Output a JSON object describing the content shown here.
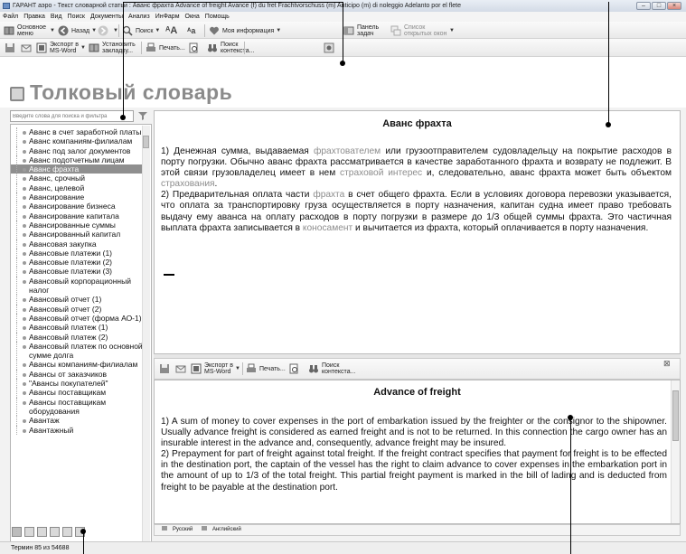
{
  "window": {
    "title": "ГАРАНТ аэро - Текст словарной статьи : Аванс фрахта Advance of freight Avance (f) du fret Frachtvorschuss (m) Anticipo (m) di noleggio Adelanto por el flete",
    "minimize": "–",
    "maximize": "□",
    "close": "×"
  },
  "menu": [
    "Файл",
    "Правка",
    "Вид",
    "Поиск",
    "Документы",
    "Анализ",
    "ИнФарм",
    "Окна",
    "Помощь"
  ],
  "toolbar1": {
    "main_menu": "Основное меню",
    "back": "Назад",
    "search": "Поиск",
    "my_info": "Моя информация",
    "tasks_panel": "Панель задач",
    "open_windows": "Список открытых окон"
  },
  "toolbar2": {
    "export_word": "Экспорт в MS-Word",
    "bookmark": "Установить закладку...",
    "print": "Печать...",
    "context_search": "Поиск контекста..."
  },
  "heading": "Толковый словарь",
  "search": {
    "placeholder": "Введите слова для поиска и фильтра"
  },
  "tree": {
    "items": [
      {
        "label": "Аванс в счет заработной платы"
      },
      {
        "label": "Аванс компаниям-филиалам"
      },
      {
        "label": "Аванс под залог документов"
      },
      {
        "label": "Аванс подотчетным лицам"
      },
      {
        "label": "Аванс фрахта",
        "selected": true
      },
      {
        "label": "Аванс, срочный"
      },
      {
        "label": "Аванс, целевой"
      },
      {
        "label": "Авансирование"
      },
      {
        "label": "Авансирование бизнеса"
      },
      {
        "label": "Авансирование капитала"
      },
      {
        "label": "Авансированные суммы"
      },
      {
        "label": "Авансированный капитал"
      },
      {
        "label": "Авансовая закупка"
      },
      {
        "label": "Авансовые платежи (1)"
      },
      {
        "label": "Авансовые платежи (2)"
      },
      {
        "label": "Авансовые платежи (3)"
      },
      {
        "label": "Авансовый корпорационный налог"
      },
      {
        "label": "Авансовый отчет (1)"
      },
      {
        "label": "Авансовый отчет (2)"
      },
      {
        "label": "Авансовый отчет (форма АО-1)"
      },
      {
        "label": "Авансовый платеж (1)"
      },
      {
        "label": "Авансовый платеж (2)"
      },
      {
        "label": "Авансовый платеж по основной сумме долга"
      },
      {
        "label": "Авансы компаниям-филиалам"
      },
      {
        "label": "Авансы от заказчиков"
      },
      {
        "label": "\"Авансы покупателей\""
      },
      {
        "label": "Авансы поставщикам"
      },
      {
        "label": "Авансы поставщикам оборудования"
      },
      {
        "label": "Авантаж"
      },
      {
        "label": "Авантажный"
      }
    ]
  },
  "article_ru": {
    "title": "Аванс фрахта",
    "p1_a": "1) Денежная сумма, выдаваемая ",
    "p1_link1": "фрахтователем",
    "p1_b": " или грузоотправителем судовладельцу на покрытие расходов в порту погрузки. Обычно аванс фрахта рассматривается в качестве заработанного фрахта и возврату не подлежит. В этой связи грузовладелец имеет в нем ",
    "p1_link2": "страховой интерес",
    "p1_c": " и, следовательно, аванс фрахта может быть объектом ",
    "p1_link3": "страхования",
    "p1_d": ".",
    "p2_a": "2) Предварительная оплата части ",
    "p2_link1": "фрахта",
    "p2_b": " в счет общего фрахта. Если в условиях договора перевозки указывается, что оплата за транспортировку груза осуществляется в порту назначения, капитан судна имеет право требовать выдачу ему аванса на оплату расходов в порту погрузки в размере до 1/3 общей суммы фрахта. Это частичная выплата фрахта записывается в ",
    "p2_link2": "коносамент",
    "p2_c": "  и вычитается из фрахта, который оплачивается в порту назначения."
  },
  "toolbar3": {
    "export_word": "Экспорт в MS-Word",
    "print": "Печать...",
    "context_search": "Поиск контекста..."
  },
  "article_en": {
    "title": "Advance of freight",
    "p1": "1) A sum of money to cover expenses in the port of embarkation issued by the freighter or the consignor to the shipowner. Usually advance freight is considered as earned freight and is not to be returned. In this connection the cargo owner has an insurable interest in the advance and, consequently, advance freight may be insured.",
    "p2": "2) Prepayment for part of freight against total freight. If the freight contract specifies that payment for freight is to be effected in the destination port, the captain of the vessel has the right to claim advance to cover expenses in the embarkation port in the amount of up to 1/3 of the total freight. This partial freight payment is marked in the bill of lading and is deducted from freight to be payable at the destination port."
  },
  "langbar": {
    "russian": "Русский",
    "english": "Английский"
  },
  "status": "Термин 85 из 54688",
  "colors": {
    "selected_item": "#8f8f8f",
    "link": "#8c8c8c",
    "heading": "#8b8b8b"
  }
}
